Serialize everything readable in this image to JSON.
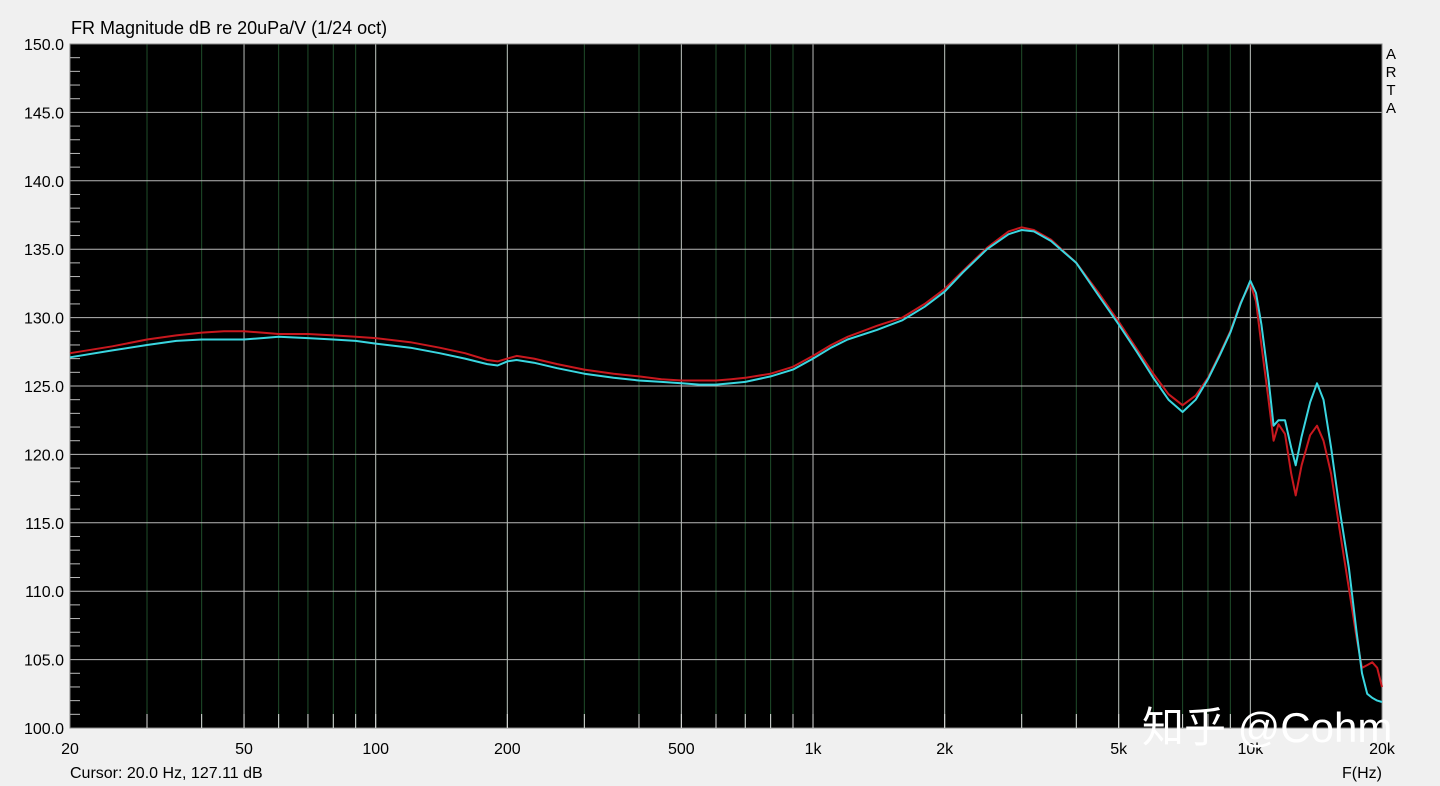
{
  "chart_data": {
    "type": "line",
    "title": "FR Magnitude dB re 20uPa/V (1/24 oct)",
    "xlabel": "F(Hz)",
    "ylabel": "",
    "x_scale": "log",
    "xlim": [
      20,
      20000
    ],
    "ylim": [
      100,
      150
    ],
    "grid": true,
    "background": "#000000",
    "x_ticks": [
      {
        "value": 20,
        "label": "20"
      },
      {
        "value": 50,
        "label": "50"
      },
      {
        "value": 100,
        "label": "100"
      },
      {
        "value": 200,
        "label": "200"
      },
      {
        "value": 500,
        "label": "500"
      },
      {
        "value": 1000,
        "label": "1k"
      },
      {
        "value": 2000,
        "label": "2k"
      },
      {
        "value": 5000,
        "label": "5k"
      },
      {
        "value": 10000,
        "label": "10k"
      },
      {
        "value": 20000,
        "label": "20k"
      }
    ],
    "y_ticks": [
      {
        "value": 100,
        "label": "100.0"
      },
      {
        "value": 105,
        "label": "105.0"
      },
      {
        "value": 110,
        "label": "110.0"
      },
      {
        "value": 115,
        "label": "115.0"
      },
      {
        "value": 120,
        "label": "120.0"
      },
      {
        "value": 125,
        "label": "125.0"
      },
      {
        "value": 130,
        "label": "130.0"
      },
      {
        "value": 135,
        "label": "135.0"
      },
      {
        "value": 140,
        "label": "140.0"
      },
      {
        "value": 145,
        "label": "145.0"
      },
      {
        "value": 150,
        "label": "150.0"
      }
    ],
    "series": [
      {
        "color": "#c8181e",
        "points": [
          [
            20,
            127.4
          ],
          [
            25,
            127.9
          ],
          [
            30,
            128.4
          ],
          [
            35,
            128.7
          ],
          [
            40,
            128.9
          ],
          [
            45,
            129.0
          ],
          [
            50,
            129.0
          ],
          [
            55,
            128.9
          ],
          [
            60,
            128.8
          ],
          [
            70,
            128.8
          ],
          [
            80,
            128.7
          ],
          [
            90,
            128.6
          ],
          [
            100,
            128.5
          ],
          [
            120,
            128.2
          ],
          [
            140,
            127.8
          ],
          [
            160,
            127.4
          ],
          [
            180,
            126.9
          ],
          [
            190,
            126.8
          ],
          [
            200,
            127.0
          ],
          [
            210,
            127.2
          ],
          [
            230,
            127.0
          ],
          [
            260,
            126.6
          ],
          [
            300,
            126.2
          ],
          [
            350,
            125.9
          ],
          [
            400,
            125.7
          ],
          [
            450,
            125.5
          ],
          [
            500,
            125.4
          ],
          [
            550,
            125.4
          ],
          [
            600,
            125.4
          ],
          [
            650,
            125.5
          ],
          [
            700,
            125.6
          ],
          [
            800,
            125.9
          ],
          [
            900,
            126.4
          ],
          [
            1000,
            127.2
          ],
          [
            1100,
            128.0
          ],
          [
            1200,
            128.6
          ],
          [
            1400,
            129.4
          ],
          [
            1600,
            130.0
          ],
          [
            1800,
            131.0
          ],
          [
            2000,
            132.1
          ],
          [
            2200,
            133.4
          ],
          [
            2500,
            135.1
          ],
          [
            2800,
            136.3
          ],
          [
            3000,
            136.6
          ],
          [
            3200,
            136.4
          ],
          [
            3500,
            135.7
          ],
          [
            4000,
            134.0
          ],
          [
            4500,
            131.8
          ],
          [
            5000,
            129.7
          ],
          [
            5500,
            127.7
          ],
          [
            6000,
            125.9
          ],
          [
            6500,
            124.4
          ],
          [
            7000,
            123.6
          ],
          [
            7500,
            124.3
          ],
          [
            8000,
            125.6
          ],
          [
            8500,
            127.3
          ],
          [
            9000,
            129.0
          ],
          [
            9500,
            131.1
          ],
          [
            10000,
            132.5
          ],
          [
            10300,
            131.2
          ],
          [
            10600,
            128.0
          ],
          [
            11000,
            124.0
          ],
          [
            11300,
            121.0
          ],
          [
            11600,
            122.2
          ],
          [
            12000,
            121.5
          ],
          [
            12400,
            118.6
          ],
          [
            12700,
            117.0
          ],
          [
            13100,
            119.2
          ],
          [
            13700,
            121.4
          ],
          [
            14200,
            122.1
          ],
          [
            14700,
            121.0
          ],
          [
            15300,
            118.6
          ],
          [
            16000,
            114.5
          ],
          [
            16800,
            110.2
          ],
          [
            17500,
            106.6
          ],
          [
            18000,
            104.4
          ],
          [
            18500,
            104.6
          ],
          [
            19000,
            104.8
          ],
          [
            19500,
            104.4
          ],
          [
            20000,
            103.0
          ]
        ]
      },
      {
        "color": "#3ad6e0",
        "points": [
          [
            20,
            127.1
          ],
          [
            25,
            127.6
          ],
          [
            30,
            128.0
          ],
          [
            35,
            128.3
          ],
          [
            40,
            128.4
          ],
          [
            45,
            128.4
          ],
          [
            50,
            128.4
          ],
          [
            55,
            128.5
          ],
          [
            60,
            128.6
          ],
          [
            70,
            128.5
          ],
          [
            80,
            128.4
          ],
          [
            90,
            128.3
          ],
          [
            100,
            128.1
          ],
          [
            120,
            127.8
          ],
          [
            140,
            127.4
          ],
          [
            160,
            127.0
          ],
          [
            180,
            126.6
          ],
          [
            190,
            126.5
          ],
          [
            200,
            126.8
          ],
          [
            210,
            126.9
          ],
          [
            230,
            126.7
          ],
          [
            260,
            126.3
          ],
          [
            300,
            125.9
          ],
          [
            350,
            125.6
          ],
          [
            400,
            125.4
          ],
          [
            450,
            125.3
          ],
          [
            500,
            125.2
          ],
          [
            550,
            125.1
          ],
          [
            600,
            125.1
          ],
          [
            650,
            125.2
          ],
          [
            700,
            125.3
          ],
          [
            800,
            125.7
          ],
          [
            900,
            126.2
          ],
          [
            1000,
            127.0
          ],
          [
            1100,
            127.8
          ],
          [
            1200,
            128.4
          ],
          [
            1400,
            129.1
          ],
          [
            1600,
            129.8
          ],
          [
            1800,
            130.8
          ],
          [
            2000,
            131.9
          ],
          [
            2200,
            133.3
          ],
          [
            2500,
            135.0
          ],
          [
            2800,
            136.1
          ],
          [
            3000,
            136.4
          ],
          [
            3200,
            136.3
          ],
          [
            3500,
            135.6
          ],
          [
            4000,
            134.0
          ],
          [
            4500,
            131.6
          ],
          [
            5000,
            129.5
          ],
          [
            5500,
            127.5
          ],
          [
            6000,
            125.6
          ],
          [
            6500,
            124.0
          ],
          [
            7000,
            123.1
          ],
          [
            7500,
            124.0
          ],
          [
            8000,
            125.5
          ],
          [
            8500,
            127.2
          ],
          [
            9000,
            128.9
          ],
          [
            9500,
            131.0
          ],
          [
            10000,
            132.7
          ],
          [
            10300,
            131.8
          ],
          [
            10600,
            129.5
          ],
          [
            11000,
            125.5
          ],
          [
            11300,
            122.1
          ],
          [
            11600,
            122.5
          ],
          [
            12000,
            122.5
          ],
          [
            12400,
            120.5
          ],
          [
            12700,
            119.2
          ],
          [
            13100,
            121.3
          ],
          [
            13700,
            123.8
          ],
          [
            14200,
            125.2
          ],
          [
            14700,
            124.0
          ],
          [
            15300,
            120.5
          ],
          [
            16000,
            116.0
          ],
          [
            16800,
            111.7
          ],
          [
            17500,
            107.0
          ],
          [
            18000,
            104.0
          ],
          [
            18500,
            102.5
          ],
          [
            19000,
            102.2
          ],
          [
            19500,
            102.0
          ],
          [
            20000,
            101.9
          ]
        ]
      }
    ]
  },
  "side_label": [
    "A",
    "R",
    "T",
    "A"
  ],
  "cursor_readout": "Cursor: 20.0 Hz, 127.11 dB",
  "watermark": "知乎 @Cohm"
}
